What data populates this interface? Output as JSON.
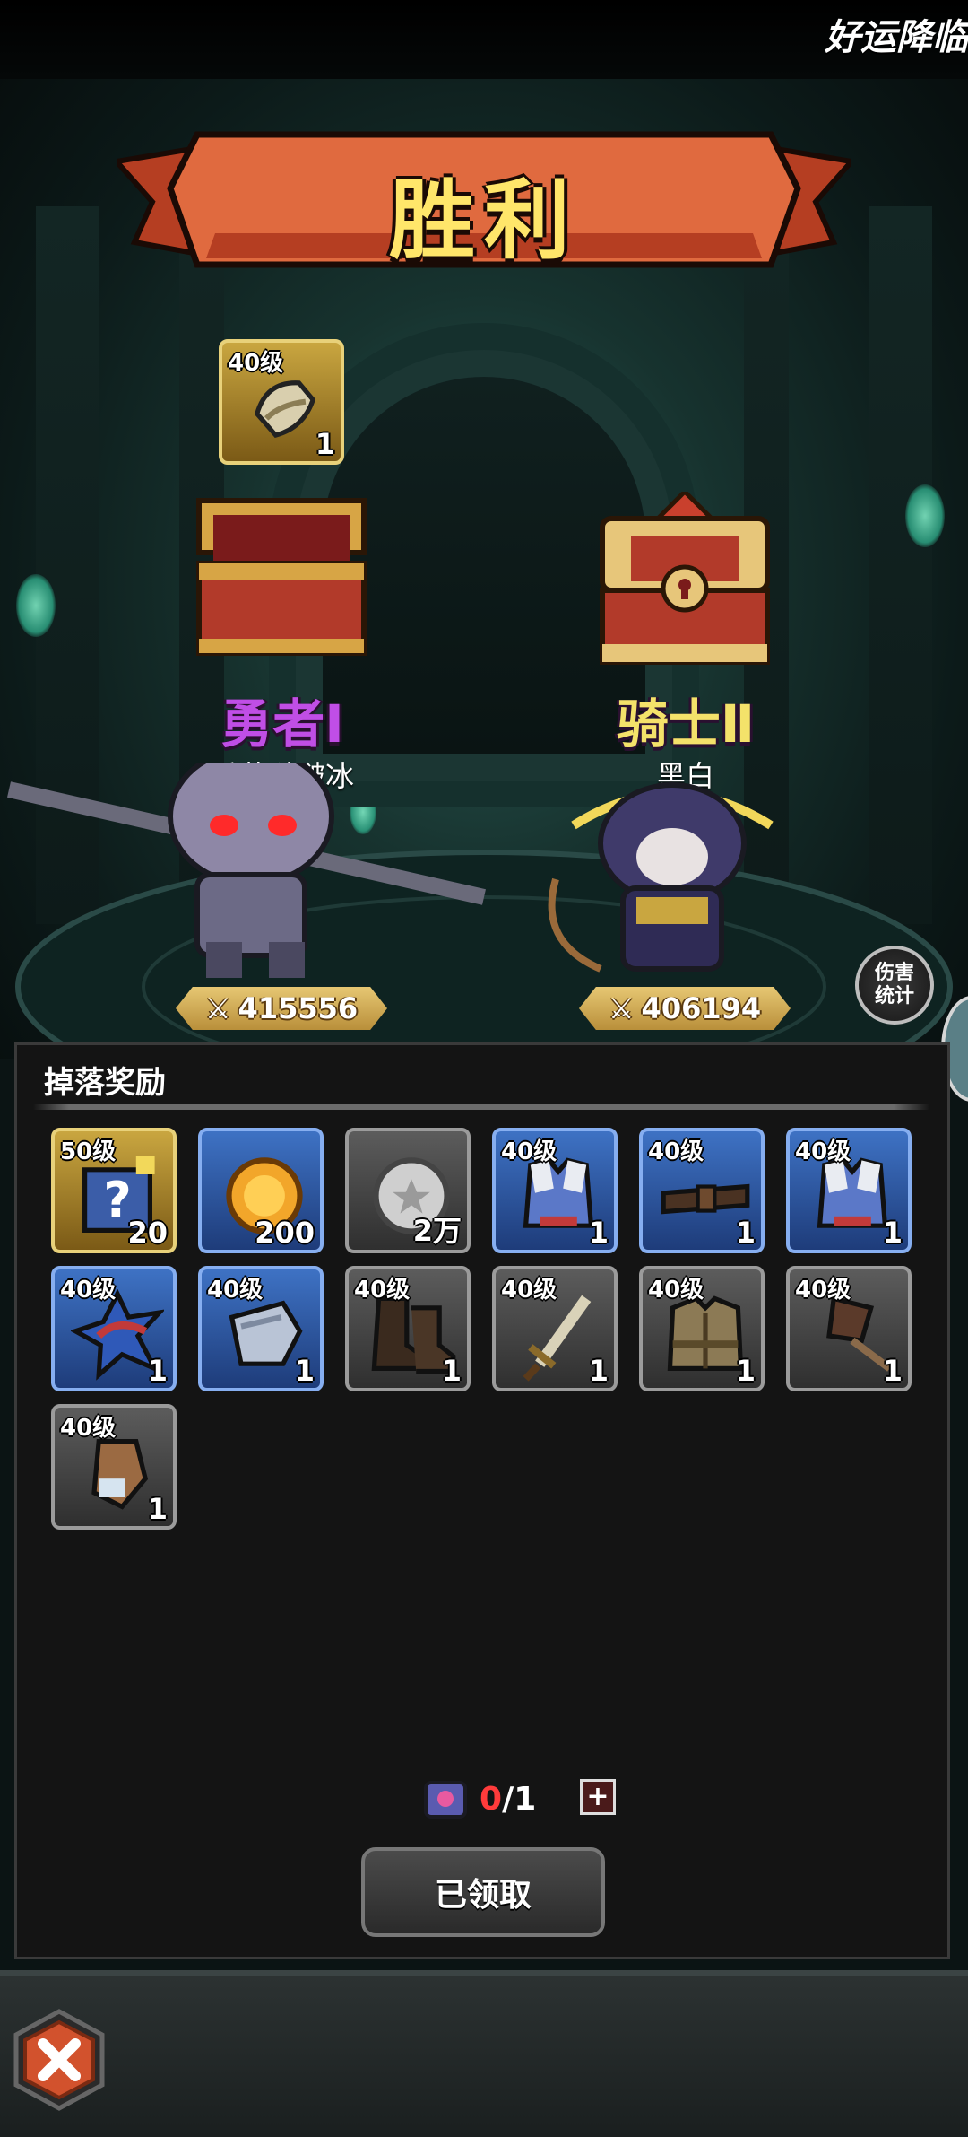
{
  "ticker_text": "好运降临",
  "title": "胜利",
  "players": [
    {
      "rank": "勇者Ⅰ",
      "name": "香芋啵啵冰",
      "power": "415556",
      "rank_color": "#c04ee6"
    },
    {
      "rank": "骑士Ⅱ",
      "name": "黑白",
      "power": "406194",
      "rank_color": "#f4e26a"
    }
  ],
  "bonus_item": {
    "level": "40级",
    "qty": "1"
  },
  "damage_stats_button": "伤害\n统计",
  "rewards": {
    "title": "掉落奖励",
    "items": [
      {
        "level": "50级",
        "qty": "20",
        "rarity": "gold",
        "icon": "puzzle-box-icon"
      },
      {
        "level": "",
        "qty": "200",
        "rarity": "blue",
        "icon": "gold-coin-icon"
      },
      {
        "level": "",
        "qty": "2万",
        "rarity": "gray",
        "icon": "silver-coin-icon"
      },
      {
        "level": "40级",
        "qty": "1",
        "rarity": "blue",
        "icon": "armor-icon"
      },
      {
        "level": "40级",
        "qty": "1",
        "rarity": "blue",
        "icon": "belt-icon"
      },
      {
        "level": "40级",
        "qty": "1",
        "rarity": "blue",
        "icon": "armor-icon"
      },
      {
        "level": "40级",
        "qty": "1",
        "rarity": "blue",
        "icon": "spiked-pauldron-icon"
      },
      {
        "level": "40级",
        "qty": "1",
        "rarity": "blue",
        "icon": "shoulder-guard-icon"
      },
      {
        "level": "40级",
        "qty": "1",
        "rarity": "gray",
        "icon": "boots-icon"
      },
      {
        "level": "40级",
        "qty": "1",
        "rarity": "gray",
        "icon": "sword-icon"
      },
      {
        "level": "40级",
        "qty": "1",
        "rarity": "gray",
        "icon": "leather-armor-icon"
      },
      {
        "level": "40级",
        "qty": "1",
        "rarity": "gray",
        "icon": "axe-icon"
      },
      {
        "level": "40级",
        "qty": "1",
        "rarity": "gray",
        "icon": "bracer-icon"
      }
    ],
    "counter_current": "0",
    "counter_total": "/1",
    "plus_label": "+",
    "claim_label": "已领取"
  }
}
